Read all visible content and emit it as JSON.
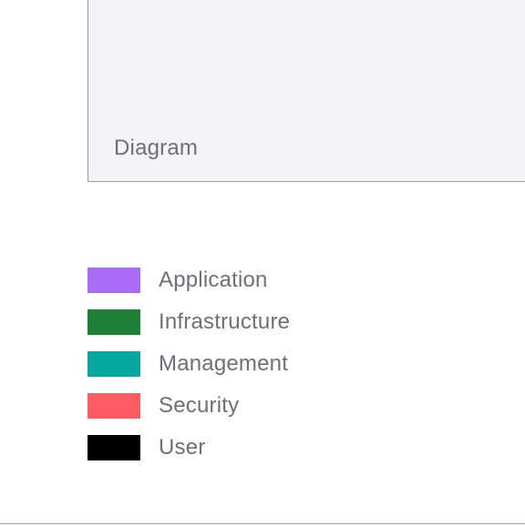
{
  "diagram": {
    "label": "Diagram"
  },
  "legend": {
    "items": [
      {
        "label": "Application",
        "color": "#a96bf5"
      },
      {
        "label": "Infrastructure",
        "color": "#1f8038"
      },
      {
        "label": "Management",
        "color": "#06a8a0"
      },
      {
        "label": "Security",
        "color": "#fd5c63"
      },
      {
        "label": "User",
        "color": "#000000"
      }
    ]
  }
}
